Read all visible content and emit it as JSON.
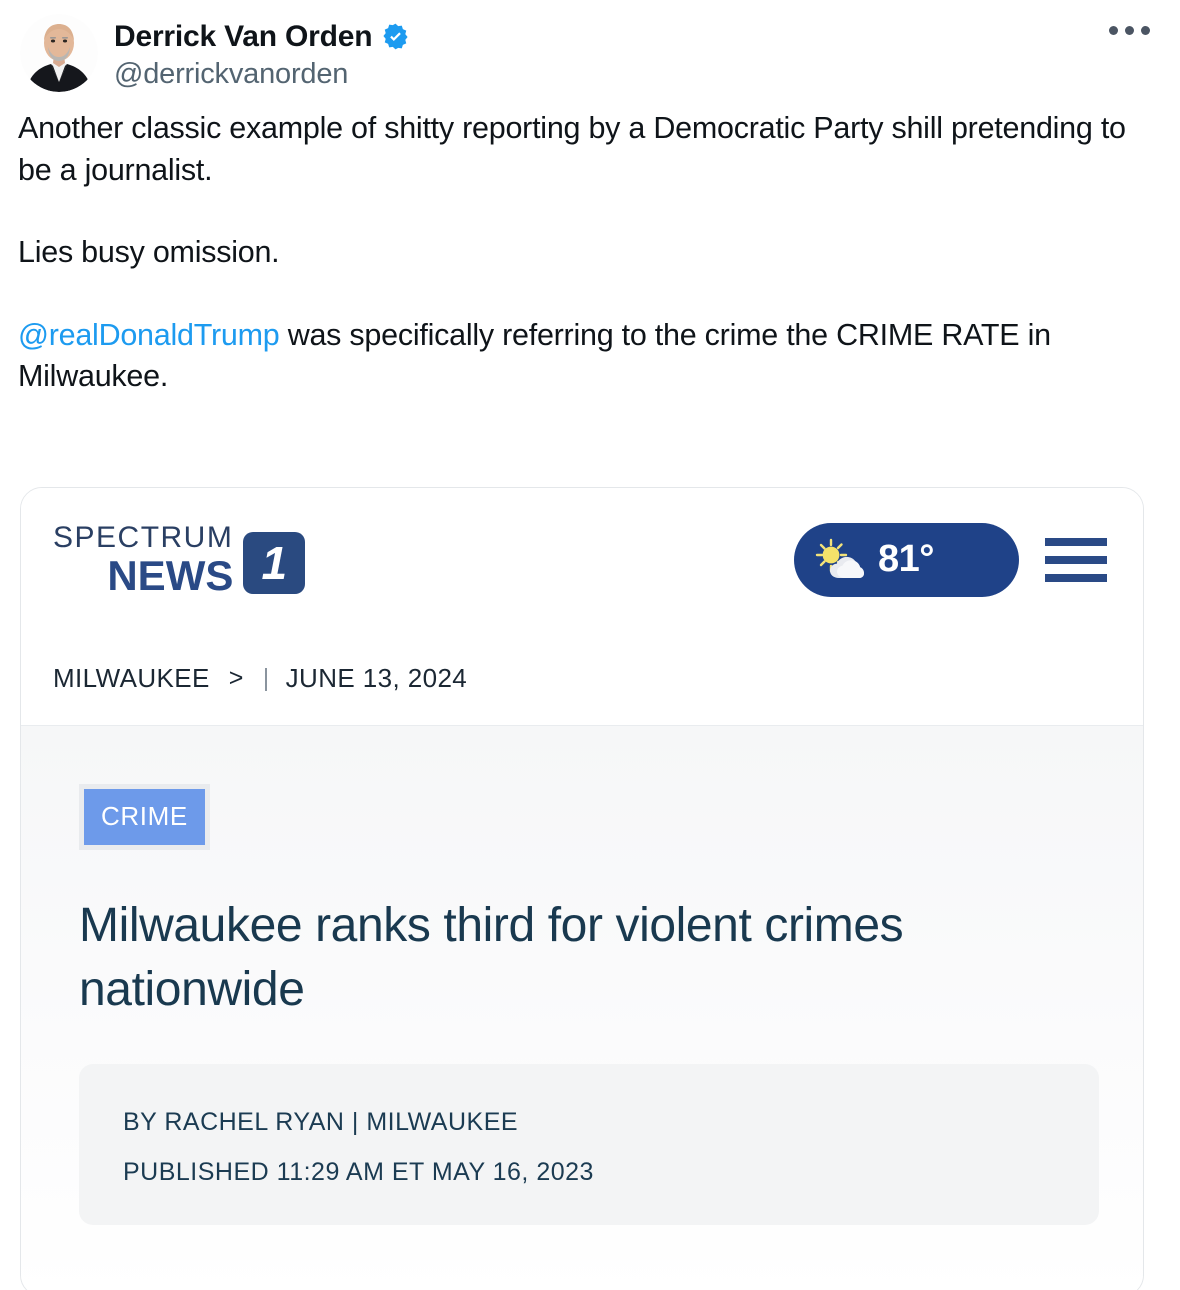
{
  "tweet": {
    "author": {
      "display_name": "Derrick Van Orden",
      "handle": "@derrickvanorden",
      "verified_badge": "verified-badge-icon",
      "avatar": "avatar-photo"
    },
    "more_menu": "more-options-icon",
    "text": {
      "paragraph_1": "Another classic example of shitty reporting by a Democratic Party shill pretending to be a journalist.",
      "paragraph_2": "Lies busy omission.",
      "mention": "@realDonaldTrump",
      "paragraph_3": " was specifically referring to the crime the CRIME RATE in Milwaukee."
    }
  },
  "card": {
    "logo": {
      "word_top": "SPECTRUM",
      "word_bottom": "NEWS",
      "channel_number": "1"
    },
    "weather": {
      "icon": "sun-behind-cloud-icon",
      "temperature": "81°"
    },
    "menu_icon": "hamburger-menu-icon",
    "breadcrumb": {
      "city": "MILWAUKEE",
      "chevron": ">",
      "separator": "|",
      "date": "JUNE 13, 2024"
    },
    "article": {
      "tag": "CRIME",
      "headline": "Milwaukee ranks third for violent crimes nationwide",
      "byline": "BY RACHEL RYAN | MILWAUKEE",
      "published": "PUBLISHED 11:29 AM ET MAY 16, 2023"
    }
  },
  "colors": {
    "twitter_blue": "#1d9bf0",
    "spectrum_navy": "#2a4a86",
    "weather_pill": "#1f4288",
    "crime_tag": "#6d9aea",
    "headline_navy": "#19394f"
  }
}
